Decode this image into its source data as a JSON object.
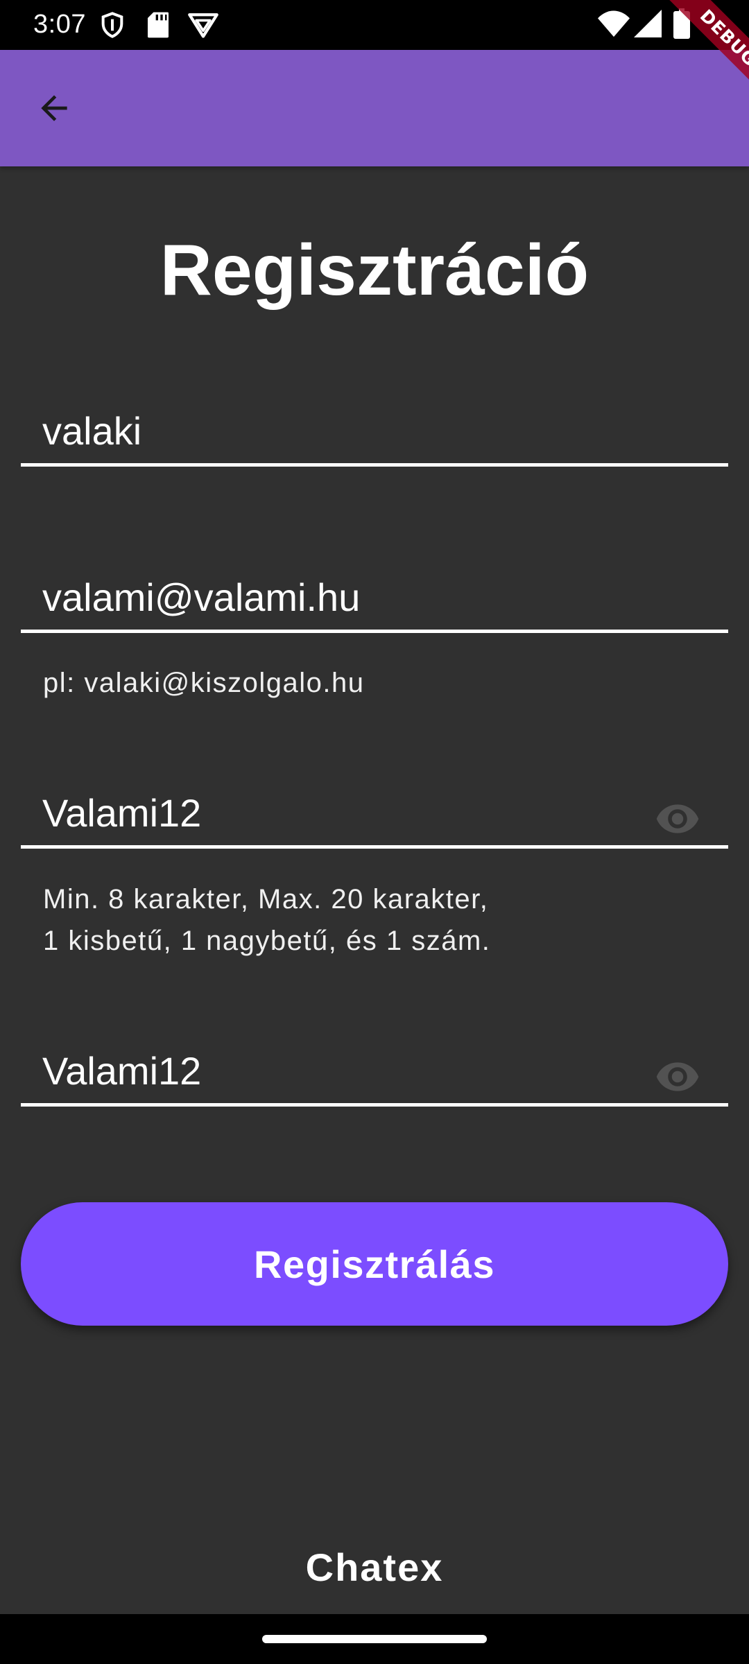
{
  "status_bar": {
    "time": "3:07",
    "icons": [
      "vpn-shield-icon",
      "sd-card-icon",
      "proton-vpn-icon",
      "wifi-icon",
      "signal-icon",
      "battery-icon"
    ]
  },
  "debug_banner": {
    "label": "DEBUG"
  },
  "app_bar": {
    "back_icon": "arrow-back-icon",
    "background_color": "#7e57c2"
  },
  "page": {
    "title": "Regisztráció",
    "background_color": "#303030"
  },
  "form": {
    "username": {
      "value": "valaki"
    },
    "email": {
      "value": "valami@valami.hu",
      "helper": "pl: valaki@kiszolgalo.hu"
    },
    "password": {
      "value": "Valami12",
      "helper_line1": "Min. 8 karakter, Max. 20 karakter,",
      "helper_line2": "1 kisbetű, 1 nagybetű, és 1 szám.",
      "visibility_icon": "eye-icon"
    },
    "password_confirm": {
      "value": "Valami12",
      "visibility_icon": "eye-icon"
    },
    "submit_label": "Regisztrálás",
    "submit_color": "#7c4dff"
  },
  "footer": {
    "brand": "Chatex"
  }
}
